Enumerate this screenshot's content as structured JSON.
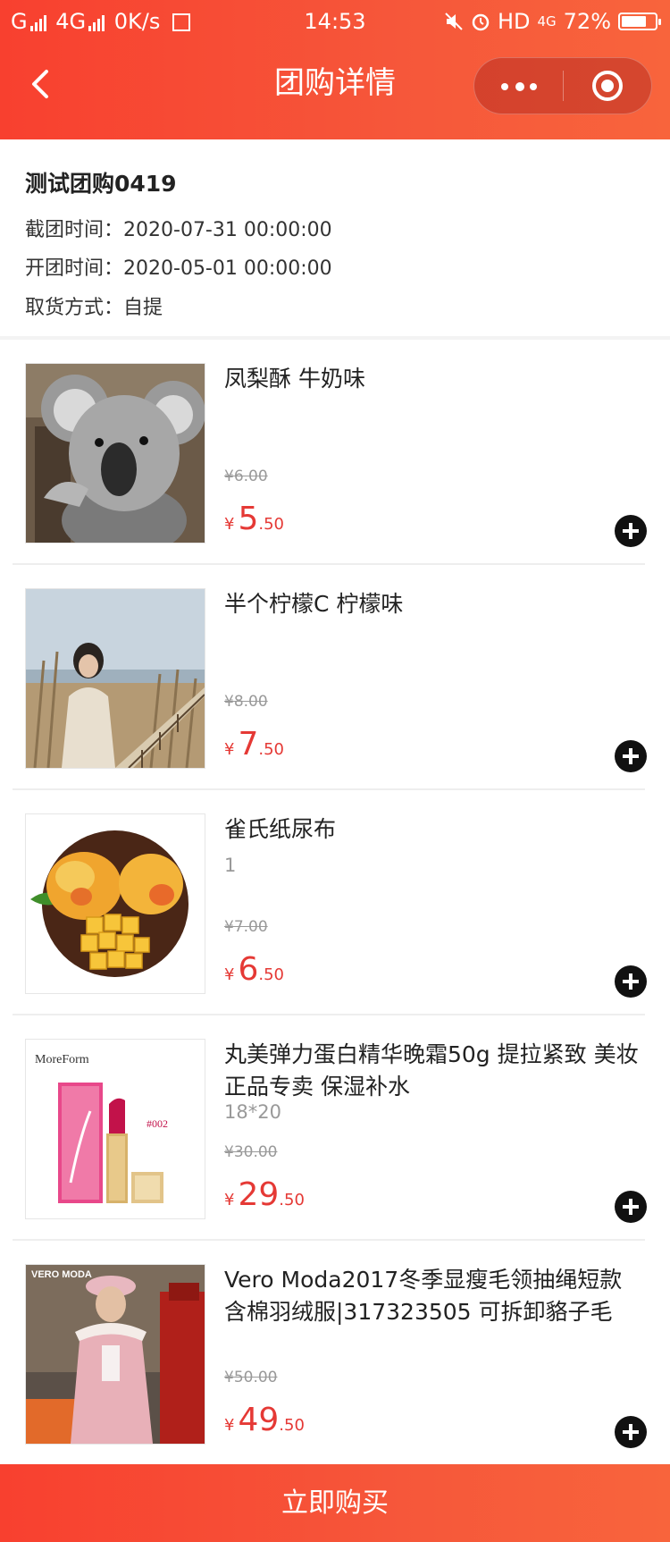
{
  "status_bar": {
    "left_text_1": "G",
    "left_text_2": "4G",
    "speed": "0K/s",
    "extra_icon": "notification-icon",
    "time": "14:53",
    "hd": "HD",
    "net": "4G",
    "battery": "72%"
  },
  "header": {
    "title": "团购详情",
    "back_icon": "chevron-left-icon",
    "more_icon": "more-dots-icon",
    "close_icon": "target-icon",
    "bg_color": "#f6573a"
  },
  "group": {
    "name": "测试团购0419",
    "deadline_label": "截团时间：",
    "deadline_value": "2020-07-31 00:00:00",
    "start_label": "开团时间：",
    "start_value": "2020-05-01 00:00:00",
    "pickup_label": "取货方式：",
    "pickup_value": "自提"
  },
  "products": [
    {
      "name": "凤梨酥 牛奶味",
      "spec": "",
      "original_price": "¥6.00",
      "currency": "¥",
      "price_int": "5",
      "price_dec": ".50",
      "image": "koala"
    },
    {
      "name": "半个柠檬C 柠檬味",
      "spec": "",
      "original_price": "¥8.00",
      "currency": "¥",
      "price_int": "7",
      "price_dec": ".50",
      "image": "woman-field"
    },
    {
      "name": "雀氏纸尿布",
      "spec": "1",
      "original_price": "¥7.00",
      "currency": "¥",
      "price_int": "6",
      "price_dec": ".50",
      "image": "mango"
    },
    {
      "name": "丸美弹力蛋白精华晚霜50g 提拉紧致 美妆正品专卖 保湿补水",
      "spec": "18*20",
      "original_price": "¥30.00",
      "currency": "¥",
      "price_int": "29",
      "price_dec": ".50",
      "image": "lipstick",
      "image_brand": "MoreForm",
      "image_shade": "#002"
    },
    {
      "name": "Vero Moda2017冬季显瘦毛领抽绳短款含棉羽绒服|317323505 可拆卸貉子毛",
      "spec": "",
      "original_price": "¥50.00",
      "currency": "¥",
      "price_int": "49",
      "price_dec": ".50",
      "image": "fashion-model",
      "image_brand": "VERO MODA"
    }
  ],
  "footer": {
    "buy_label": "立即购买"
  },
  "colors": {
    "accent": "#f6573a",
    "price": "#e53935"
  }
}
